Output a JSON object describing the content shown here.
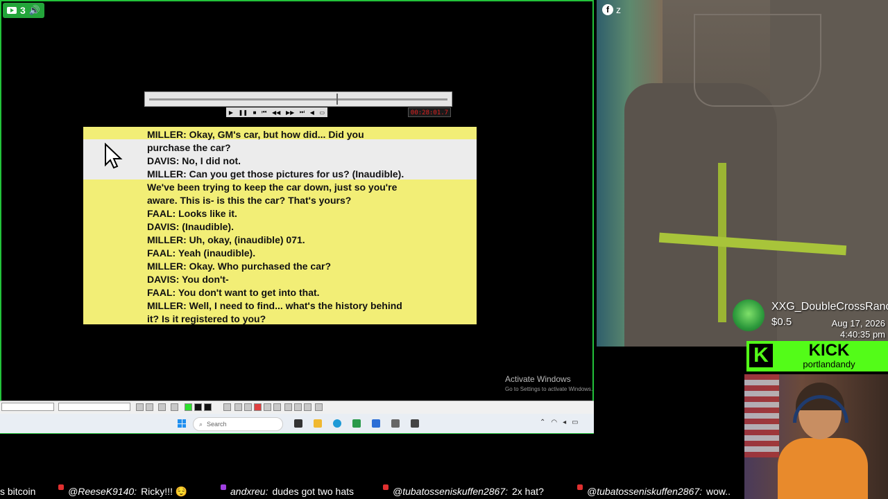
{
  "stream": {
    "viewer_count": "3",
    "facebook_label": "z"
  },
  "player": {
    "timecode": "00:28:01.7"
  },
  "transcript": {
    "lines": [
      "MILLER: Okay, GM's car, but how did... Did you",
      "purchase the car?",
      "DAVIS: No, I did not.",
      "MILLER: Can you get those pictures for us? (Inaudible).",
      "We've been trying to keep the car down, just so you're",
      "aware. This is- is this the car? That's yours?",
      "FAAL: Looks like it.",
      "DAVIS: (Inaudible).",
      "MILLER: Uh, okay, (inaudible) 071.",
      "FAAL: Yeah (inaudible).",
      "MILLER: Okay. Who purchased the car?",
      "DAVIS: You don't-",
      "FAAL: You don't want to get into that.",
      "MILLER: Well, I need to find... what's the history behind",
      "it? Is it registered to you?"
    ]
  },
  "windows": {
    "activate_title": "Activate Windows",
    "activate_sub": "Go to Settings to activate Windows.",
    "search_placeholder": "Search"
  },
  "tip": {
    "name": "XXG_DoubleCrossRanch",
    "amount": "$0.5",
    "date": "Aug 17, 2026",
    "time": "4:40:35 pm"
  },
  "kick": {
    "brand": "KICK",
    "username": "portlandandy"
  },
  "chat": [
    {
      "user": "",
      "message": "s bitcoin"
    },
    {
      "user": "@ReeseK9140:",
      "message": "Ricky!!! 😌"
    },
    {
      "user": "andxreu:",
      "message": "dudes got two hats"
    },
    {
      "user": "@tubatosseniskuffen2867:",
      "message": "2x hat?"
    },
    {
      "user": "@tubatosseniskuffen2867:",
      "message": "wow.."
    }
  ],
  "colors": {
    "accent_green": "#22c33a",
    "kick_green": "#53fc18",
    "transcript_yellow": "#f2ee76"
  }
}
